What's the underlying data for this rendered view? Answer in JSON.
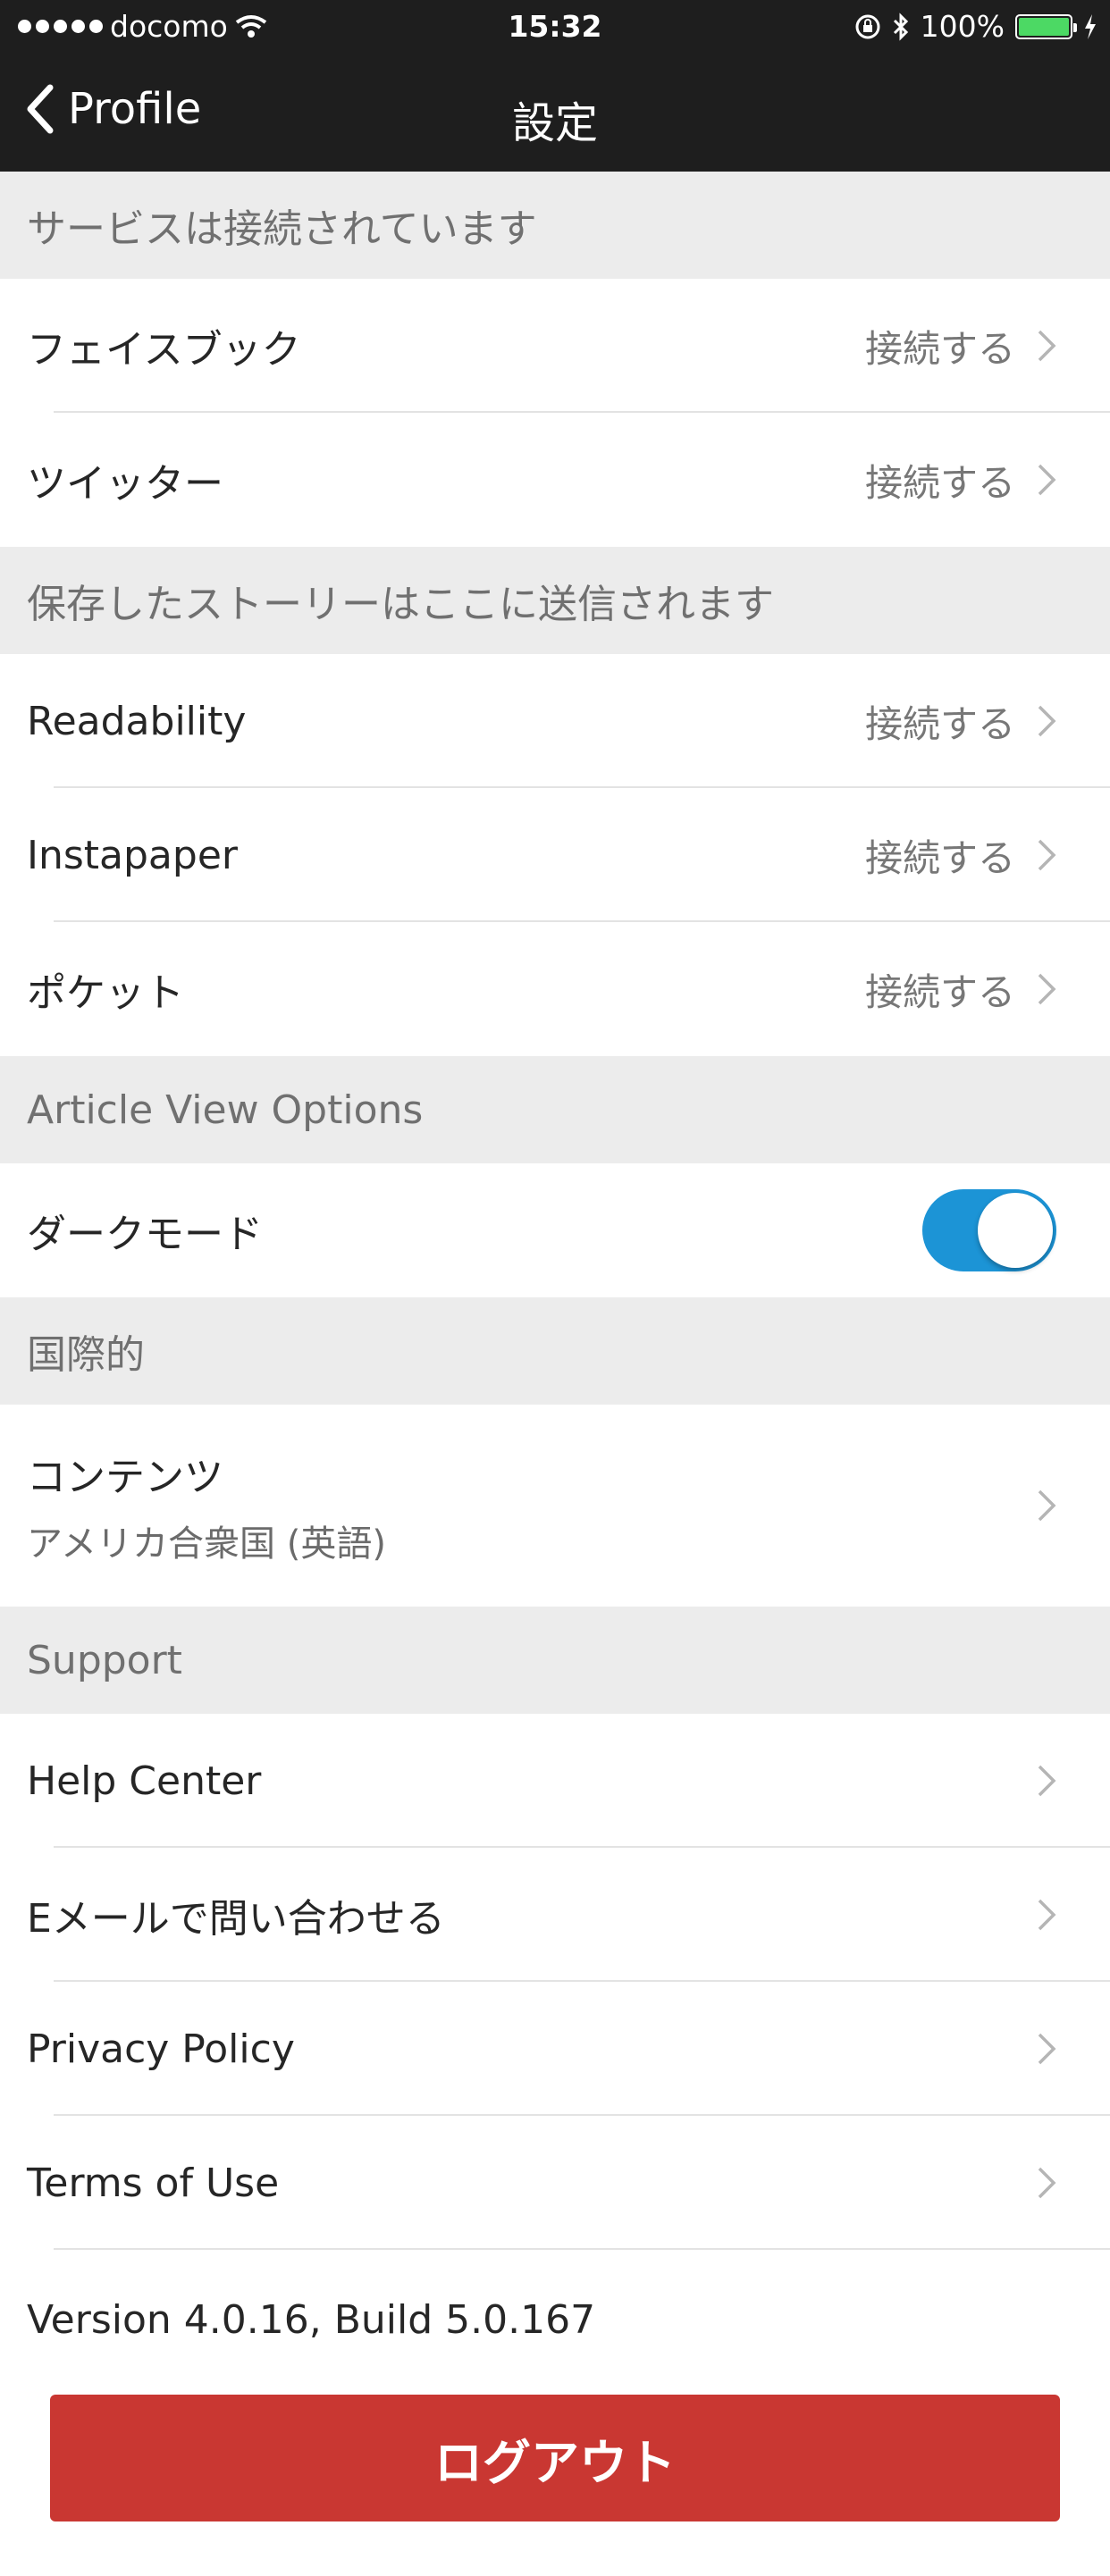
{
  "status_bar": {
    "carrier": "docomo",
    "time": "15:32",
    "battery": "100%"
  },
  "nav": {
    "back_label": "Profile",
    "title": "設定"
  },
  "sections": {
    "connected": {
      "header": "サービスは接続されています",
      "items": [
        {
          "label": "フェイスブック",
          "value": "接続する"
        },
        {
          "label": "ツイッター",
          "value": "接続する"
        }
      ]
    },
    "saved": {
      "header": "保存したストーリーはここに送信されます",
      "items": [
        {
          "label": "Readability",
          "value": "接続する"
        },
        {
          "label": "Instapaper",
          "value": "接続する"
        },
        {
          "label": "ポケット",
          "value": "接続する"
        }
      ]
    },
    "article": {
      "header": "Article View Options",
      "dark_mode_label": "ダークモード",
      "dark_mode_on": true
    },
    "intl": {
      "header": "国際的",
      "content_label": "コンテンツ",
      "content_value": "アメリカ合衆国 (英語)"
    },
    "support": {
      "header": "Support",
      "items": [
        {
          "label": "Help Center"
        },
        {
          "label": "Eメールで問い合わせる"
        },
        {
          "label": "Privacy Policy"
        },
        {
          "label": "Terms of Use"
        }
      ]
    }
  },
  "version": "Version 4.0.16, Build 5.0.167",
  "logout_label": "ログアウト",
  "colors": {
    "nav_bg": "#1e1e1e",
    "toggle_on": "#1c94d6",
    "logout": "#c93732"
  }
}
